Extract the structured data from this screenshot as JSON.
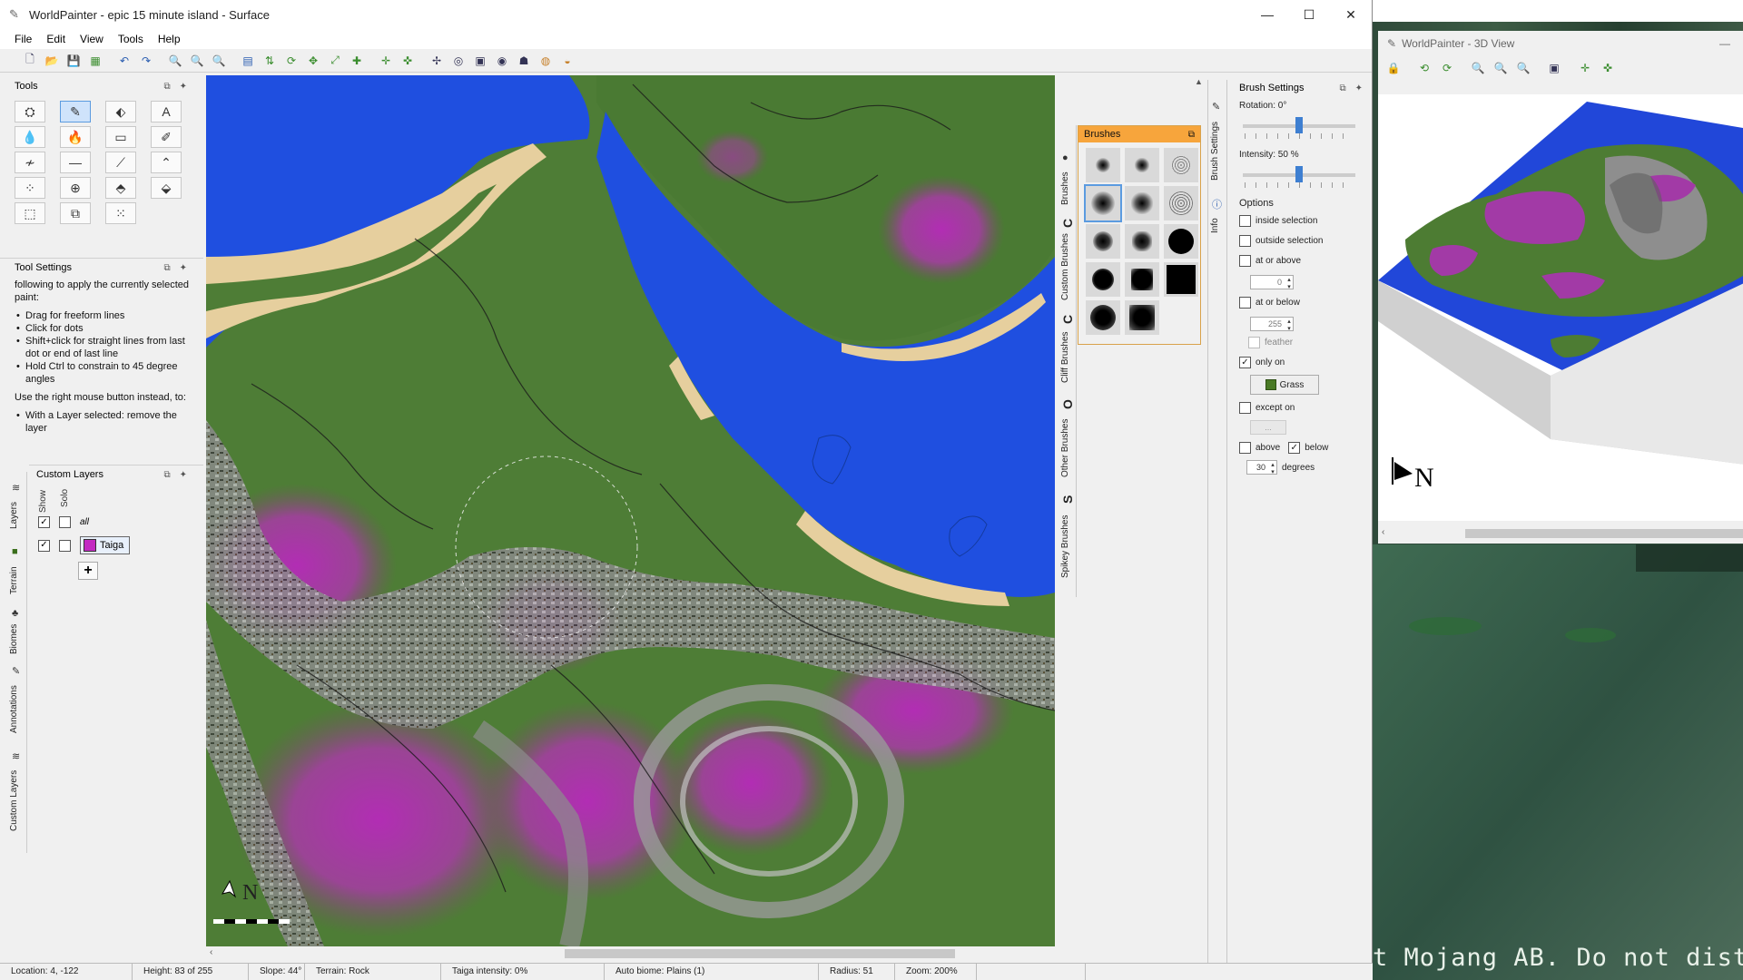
{
  "window": {
    "title": "WorldPainter - epic 15 minute island - Surface",
    "controls": [
      "—",
      "☐",
      "✕"
    ]
  },
  "menu": [
    "File",
    "Edit",
    "View",
    "Tools",
    "Help"
  ],
  "panels": {
    "tools": {
      "title": "Tools"
    },
    "tool_settings": {
      "title": "Tool Settings",
      "intro": "following to apply the currently selected paint:",
      "left_items": [
        "Drag for freeform lines",
        "Click for dots",
        "Shift+click for straight lines from last dot or end of last line",
        "Hold Ctrl to constrain to 45 degree angles"
      ],
      "right_intro": "Use the right mouse button instead, to:",
      "right_items": [
        "With a Layer selected: remove the layer"
      ]
    },
    "custom_layers": {
      "title": "Custom Layers",
      "col_show": "Show",
      "col_solo": "Solo",
      "all_label": "all",
      "layer_name": "Taiga",
      "add_label": "+"
    },
    "side_tabs": [
      "Layers",
      "Terrain",
      "Biomes",
      "Annotations",
      "Custom Layers"
    ]
  },
  "brushes": {
    "title": "Brushes",
    "tabs": [
      "Brushes",
      "C",
      "Custom Brushes",
      "C",
      "Cliff Brushes",
      "O",
      "Other Brushes",
      "S",
      "Spikey Brushes"
    ]
  },
  "brush_settings": {
    "title": "Brush Settings",
    "side_tabs": [
      "Brush Settings",
      "Info"
    ],
    "rotation_label": "Rotation: 0°",
    "rotation_value": 0.5,
    "intensity_label": "Intensity: 50 %",
    "intensity_value": 0.5,
    "options_label": "Options",
    "inside_selection": "inside selection",
    "outside_selection": "outside selection",
    "at_or_above": "at or above",
    "at_or_above_value": "0",
    "at_or_below": "at or below",
    "at_or_below_value": "255",
    "feather": "feather",
    "only_on": "only on",
    "only_on_value": "Grass",
    "except_on": "except on",
    "except_on_value": "...",
    "above": "above",
    "below": "below",
    "degrees_value": "30",
    "degrees_label": "degrees"
  },
  "status": {
    "location": "Location: 4, -122",
    "height": "Height: 83 of 255",
    "slope": "Slope: 44°",
    "terrain": "Terrain: Rock",
    "layer": "Taiga intensity: 0%",
    "biome": "Auto biome: Plains (1)",
    "radius": "Radius: 51",
    "zoom": "Zoom: 200%"
  },
  "map": {
    "compass": "N"
  },
  "view3d": {
    "title": "WorldPainter - 3D View",
    "minimize": "—",
    "compass": "N"
  },
  "background_text": "t Mojang AB. Do not distril"
}
